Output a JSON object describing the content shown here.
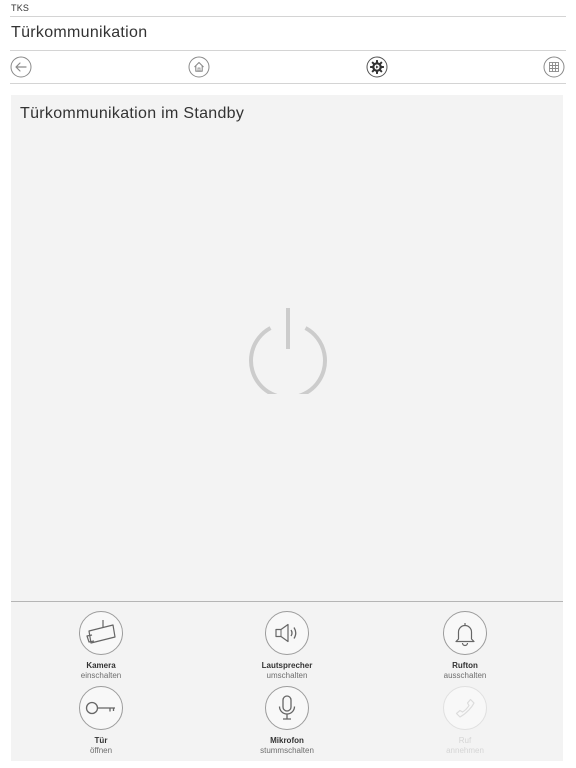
{
  "app": {
    "label": "TKS"
  },
  "header": {
    "title": "Türkommunikation"
  },
  "nav": {
    "back_icon": "arrow-left-icon",
    "home_icon": "home-icon",
    "settings_icon": "gear-icon",
    "grid_icon": "grid-icon"
  },
  "panel": {
    "title": "Türkommunikation im Standby",
    "power_icon": "power-icon"
  },
  "controls": {
    "camera": {
      "line1": "Kamera",
      "line2": "einschalten",
      "icon": "camera-icon"
    },
    "speaker": {
      "line1": "Lautsprecher",
      "line2": "umschalten",
      "icon": "speaker-icon"
    },
    "ringtone": {
      "line1": "Rufton",
      "line2": "ausschalten",
      "icon": "bell-icon"
    },
    "door": {
      "line1": "Tür",
      "line2": "öffnen",
      "icon": "key-icon"
    },
    "mic": {
      "line1": "Mikrofon",
      "line2": "stummschalten",
      "icon": "microphone-icon"
    },
    "call": {
      "line1": "Ruf",
      "line2": "annehmen",
      "icon": "phone-icon",
      "state": "disabled"
    }
  },
  "colors": {
    "panel_bg": "#f3f3f3",
    "text": "#333333",
    "icon_stroke": "#777777",
    "power_stroke": "#cccccc"
  }
}
